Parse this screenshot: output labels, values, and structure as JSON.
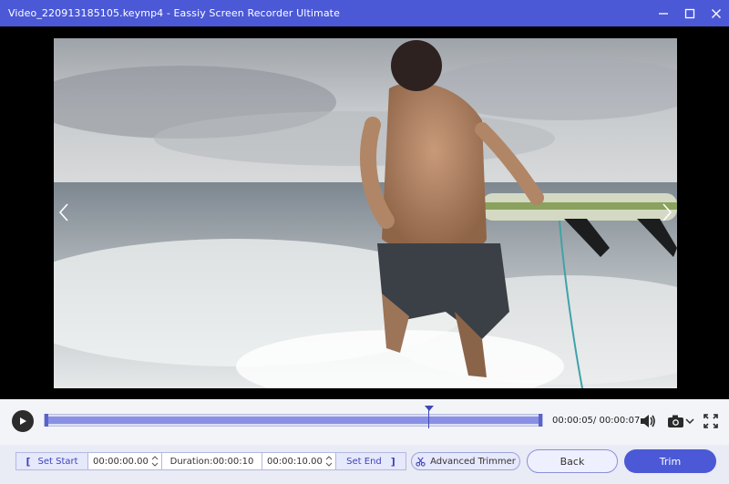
{
  "window": {
    "title": "Video_220913185105.keymp4  -  Eassiy Screen Recorder Ultimate",
    "controls": [
      "minimize-icon",
      "maximize-icon",
      "close-icon"
    ]
  },
  "player": {
    "current_time": "00:00:05",
    "total_time": "00:00:07",
    "time_display": "00:00:05/ 00:00:07",
    "progress": 0.77
  },
  "trim": {
    "set_start_label": "Set Start",
    "start_time": "00:00:00.00",
    "duration": "Duration:00:00:10",
    "end_time": "00:00:10.00",
    "set_end_label": "Set End",
    "advanced_trimmer_label": "Advanced Trimmer",
    "back_label": "Back",
    "trim_label": "Trim"
  },
  "colors": {
    "accent": "#4b59d6",
    "track_fill": "#8890e6",
    "track_bg": "#dcdff1",
    "control_bg": "#e9ebf5"
  }
}
